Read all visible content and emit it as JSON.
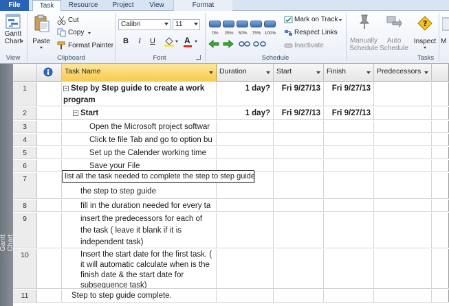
{
  "tabs": [
    "File",
    "Task",
    "Resource",
    "Project",
    "View",
    "Format"
  ],
  "ribbon": {
    "view_group": {
      "gantt_label_1": "Gantt",
      "gantt_label_2": "Chart",
      "label": "View"
    },
    "clipboard": {
      "paste": "Paste",
      "cut": "Cut",
      "copy": "Copy",
      "format_painter": "Format Painter",
      "label": "Clipboard"
    },
    "font": {
      "family": "Calibri",
      "size": "11",
      "bold": "B",
      "italic": "I",
      "underline": "U",
      "color_letter": "A",
      "label": "Font"
    },
    "schedule": {
      "percent_buttons": [
        "0%",
        "25%",
        "50%",
        "75%",
        "100%"
      ],
      "mark_on_track": "Mark on Track",
      "respect_links": "Respect Links",
      "inactivate": "Inactivate",
      "label": "Schedule"
    },
    "tasks": {
      "manually_1": "Manually",
      "manually_2": "Schedule",
      "auto_1": "Auto",
      "auto_2": "Schedule",
      "inspect": "Inspect",
      "more": "M",
      "label": "Tasks"
    }
  },
  "side_label": "Gantt Chart",
  "grid": {
    "headers": {
      "taskname": "Task Name",
      "duration": "Duration",
      "start": "Start",
      "finish": "Finish",
      "predecessors": "Predecessors"
    },
    "rows": [
      {
        "num": "1",
        "name": "Step by Step guide to create a work program",
        "duration": "1 day?",
        "start": "Fri 9/27/13",
        "finish": "Fri 9/27/13"
      },
      {
        "num": "2",
        "name": "Start",
        "duration": "1 day?",
        "start": "Fri 9/27/13",
        "finish": "Fri 9/27/13"
      },
      {
        "num": "3",
        "name": "Open the Microsoft project softwar"
      },
      {
        "num": "4",
        "name": "Click te file Tab and go to option bu"
      },
      {
        "num": "5",
        "name": "Set up the Calender working time"
      },
      {
        "num": "6",
        "name": "Save your File"
      },
      {
        "num": "7",
        "name": "the step to step guide"
      },
      {
        "num": "8",
        "name": "fill in the duration needed for every ta"
      },
      {
        "num": "9",
        "name": "insert the predecessors for each of the task ( leave it blank if it is independent task)"
      },
      {
        "num": "10",
        "name": "Insert the start date for the first task. ( it will automatic calculate when is the finish date & the start date for subsequence task)"
      },
      {
        "num": "11",
        "name": "Step to step guide complete."
      }
    ],
    "edit_text": "list all the task needed to complete the step to step guide"
  }
}
